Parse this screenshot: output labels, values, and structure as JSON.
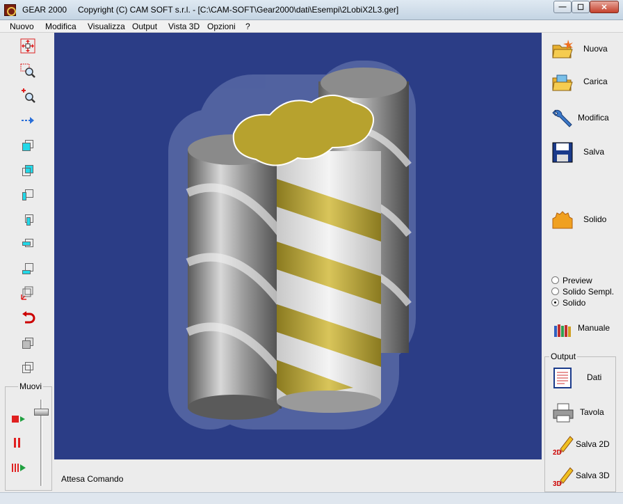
{
  "window": {
    "app_name": "GEAR 2000",
    "title": "Copyright (C)  CAM SOFT s.r.l. - [C:\\CAM-SOFT\\Gear2000\\dati\\Esempi\\2LobiX2L3.ger]",
    "controls": {
      "minimize": "—",
      "maximize": "☐",
      "close": "✕"
    }
  },
  "menu": {
    "items": [
      "Nuovo",
      "Modifica",
      "Visualizza",
      "Output",
      "Vista 3D",
      "Opzioni",
      "?"
    ]
  },
  "left_toolbar": {
    "tools": [
      "pan-icon",
      "zoom-window-icon",
      "zoom-in-icon",
      "move-arrow-icon",
      "cube-front-icon",
      "cube-back-icon",
      "cube-left-icon",
      "cube-right-icon",
      "cube-top-icon",
      "cube-bottom-icon",
      "cube-axes-icon",
      "rotate-icon",
      "solid-cube-icon",
      "wire-cube-icon"
    ],
    "move_group": {
      "label": "Muovi"
    }
  },
  "right_panel": {
    "buttons": {
      "nuova": "Nuova",
      "carica": "Carica",
      "modifica": "Modifica",
      "salva": "Salva",
      "solido": "Solido",
      "manuale": "Manuale"
    },
    "render_mode": {
      "options": [
        "Preview",
        "Solido Sempl.",
        "Solido"
      ],
      "selected": "Solido"
    },
    "output": {
      "label": "Output",
      "dati": "Dati",
      "tavola": "Tavola",
      "salva_2d": "Salva 2D",
      "salva_3d": "Salva 3D"
    }
  },
  "status": {
    "text": "Attesa Comando"
  },
  "colors": {
    "viewport_bg": "#2b3d86",
    "gear_gold": "#c9b23a",
    "gear_steel": "#a8a8a8"
  }
}
